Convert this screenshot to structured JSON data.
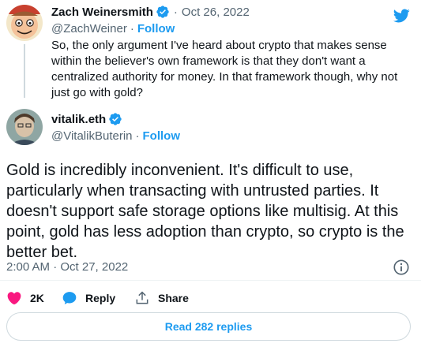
{
  "parent_tweet": {
    "author_name": "Zach Weinersmith",
    "handle": "@ZachWeiner",
    "separator": "·",
    "follow_label": "Follow",
    "date_separator": "·",
    "date": "Oct 26, 2022",
    "text_lines": [
      "So, the only argument I've heard about crypto that makes sense",
      "within the believer's own framework is that they don't want a",
      "centralized authority for money. In that framework though, why not",
      "just go with gold?"
    ]
  },
  "main_tweet": {
    "author_name": "vitalik.eth",
    "handle": "@VitalikButerin",
    "separator": "·",
    "follow_label": "Follow",
    "text_lines": [
      "Gold is incredibly inconvenient. It's difficult to use,",
      "particularly when transacting with untrusted parties. It",
      "doesn't support safe storage options like multisig. At this",
      "point, gold has less adoption than crypto, so crypto is the",
      "better bet."
    ],
    "timestamp": "2:00 AM · Oct 27, 2022"
  },
  "actions": {
    "like_count": "2K",
    "reply_label": "Reply",
    "share_label": "Share"
  },
  "read_replies_label": "Read 282 replies",
  "icons": {
    "brand": "twitter-bird-icon",
    "verified": "verified-badge-icon",
    "info": "info-icon",
    "like": "heart-icon",
    "reply": "speech-bubble-icon",
    "share": "share-icon"
  },
  "colors": {
    "accent": "#1d9bf0",
    "like": "#f91880",
    "text": "#0f1419",
    "muted": "#536471",
    "border": "#cfd9de"
  }
}
